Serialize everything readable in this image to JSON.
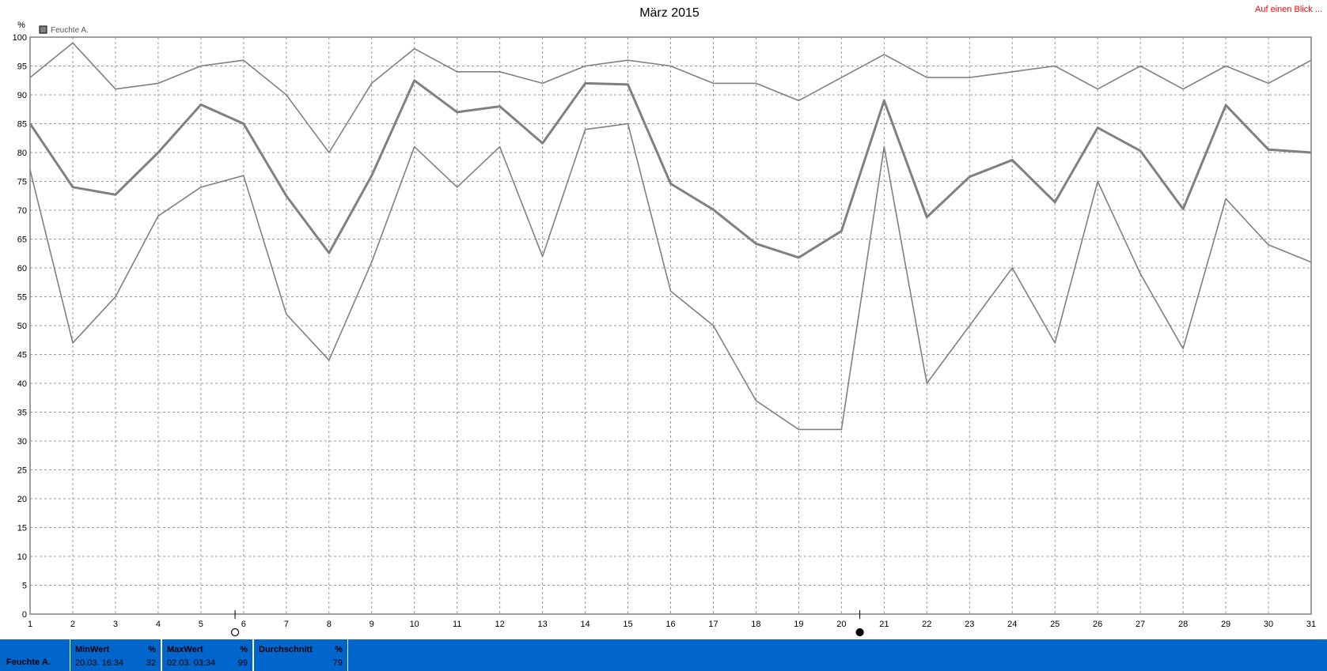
{
  "header": {
    "link_label": "Auf einen Blick ..."
  },
  "chart_data": {
    "type": "line",
    "title": "März 2015",
    "ylabel": "%",
    "xlabel": "",
    "ylim": [
      0,
      100
    ],
    "ytick_step": 5,
    "grid": true,
    "legend_position": "top-left",
    "legend": [
      {
        "label": "Feuchte A.",
        "color": "#808080"
      }
    ],
    "x": [
      1,
      2,
      3,
      4,
      5,
      6,
      7,
      8,
      9,
      10,
      11,
      12,
      13,
      14,
      15,
      16,
      17,
      18,
      19,
      20,
      21,
      22,
      23,
      24,
      25,
      26,
      27,
      28,
      29,
      30,
      31
    ],
    "series": [
      {
        "role": "max",
        "color": "#808080",
        "values": [
          93,
          99,
          91,
          92,
          95,
          96,
          90,
          80,
          92,
          98,
          94,
          94,
          92,
          95,
          96,
          95,
          92,
          92,
          89,
          93,
          97,
          93,
          93,
          94,
          95,
          91,
          95,
          91,
          95,
          92,
          96
        ]
      },
      {
        "role": "avg",
        "color": "#808080",
        "values": [
          85,
          74,
          72.7,
          80,
          88.3,
          85,
          72.5,
          62.6,
          76,
          92.5,
          87,
          88,
          81.6,
          92,
          91.8,
          74.6,
          70.1,
          64.2,
          61.8,
          66.4,
          89,
          68.8,
          75.8,
          78.7,
          71.4,
          84.3,
          80.3,
          70.2,
          88.2,
          80.5,
          80
        ]
      },
      {
        "role": "min",
        "color": "#808080",
        "values": [
          77,
          47,
          55,
          69,
          74,
          76,
          52,
          44,
          61,
          81,
          74,
          81,
          62,
          84,
          85,
          56,
          50,
          37,
          32,
          32,
          81,
          40,
          50,
          60,
          47,
          75,
          59,
          46,
          72,
          64,
          61
        ]
      }
    ],
    "markers": [
      {
        "x": 5.8,
        "symbol": "circle-open"
      },
      {
        "x": 20.43,
        "symbol": "circle-filled"
      }
    ]
  },
  "stats": {
    "sensor_label": "Feuchte A.",
    "min": {
      "header": "MinWert",
      "unit": "%",
      "time": "20.03.  16:34",
      "value": "32"
    },
    "max": {
      "header": "MaxWert",
      "unit": "%",
      "time": "02.03.  03:34",
      "value": "99"
    },
    "avg": {
      "header": "Durchschnitt",
      "unit": "%",
      "value": "79"
    }
  }
}
